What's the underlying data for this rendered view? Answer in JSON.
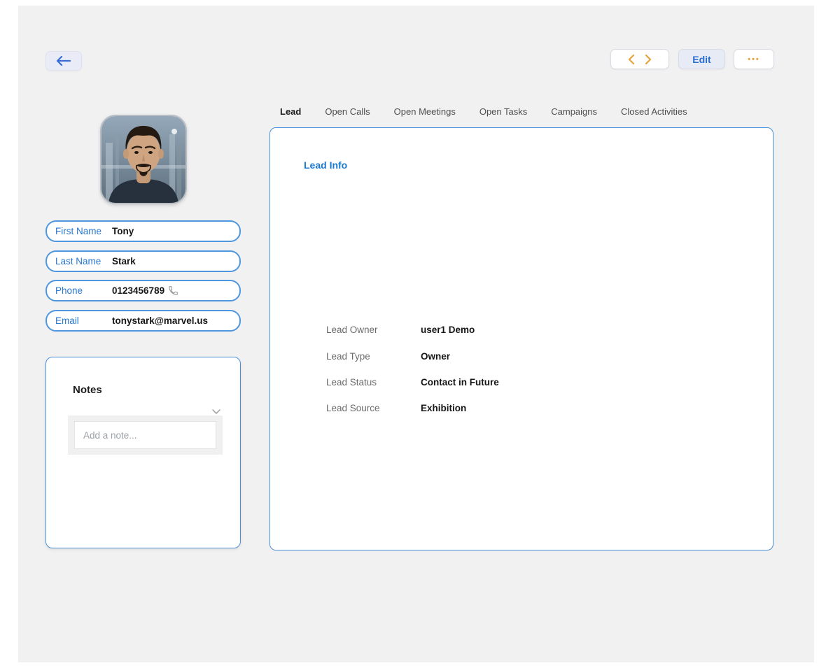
{
  "colors": {
    "panel_background": "#f1f1f2",
    "accent_blue": "#4a90d9",
    "label_blue": "#2878d0",
    "accent_orange": "#e5a33c",
    "text_dark": "#161616",
    "text_gray": "#6b6b6b"
  },
  "header": {
    "back_icon": "left-arrow",
    "prev_icon": "chevron-left",
    "next_icon": "chevron-right",
    "edit_label": "Edit",
    "more_icon": "ellipsis"
  },
  "profile": {
    "avatar_alt": "Tony Stark portrait",
    "fields": [
      {
        "label": "First Name",
        "value": "Tony"
      },
      {
        "label": "Last Name",
        "value": "Stark"
      },
      {
        "label": "Phone",
        "value": "0123456789",
        "icon": "phone-icon"
      },
      {
        "label": "Email",
        "value": "tonystark@marvel.us"
      }
    ]
  },
  "notes": {
    "title": "Notes",
    "collapse_icon": "chevron-down",
    "placeholder": "Add a note..."
  },
  "tabs": [
    {
      "label": "Lead",
      "active": true
    },
    {
      "label": "Open Calls",
      "active": false
    },
    {
      "label": "Open Meetings",
      "active": false
    },
    {
      "label": "Open Tasks",
      "active": false
    },
    {
      "label": "Campaigns",
      "active": false
    },
    {
      "label": "Closed Activities",
      "active": false
    }
  ],
  "lead_info": {
    "title": "Lead Info",
    "rows": [
      {
        "label": "Lead Owner",
        "value": "user1 Demo"
      },
      {
        "label": "Lead Type",
        "value": "Owner"
      },
      {
        "label": "Lead Status",
        "value": "Contact in Future"
      },
      {
        "label": "Lead Source",
        "value": "Exhibition"
      }
    ]
  }
}
